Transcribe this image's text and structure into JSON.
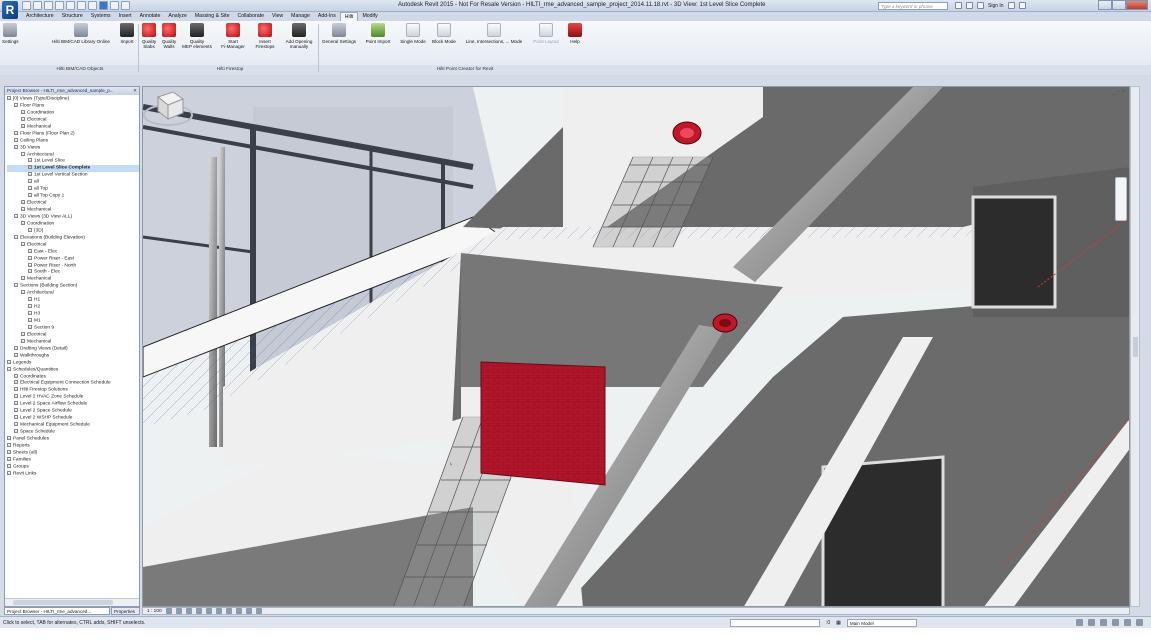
{
  "title": "Autodesk Revit 2015 - Not For Resale Version -   HILTI_rme_advanced_sample_project_2014.11.18.rvt - 3D View: 1st Level Slice Complete",
  "search_placeholder": "Type a keyword or phrase",
  "sign_in": "Sign In",
  "tabs": [
    "Architecture",
    "Structure",
    "Systems",
    "Insert",
    "Annotate",
    "Analyze",
    "Massing & Site",
    "Collaborate",
    "View",
    "Manage",
    "Add-Ins",
    "Hilti",
    "Modify"
  ],
  "active_tab": "Hilti",
  "ribbon": {
    "buttons": [
      {
        "label": "Settings",
        "icon": "settings-icon"
      },
      {
        "label": "Hilti BIM/CAD Library Online",
        "icon": "library-icon"
      },
      {
        "label": "Import",
        "icon": "import-icon"
      },
      {
        "label": "Quality\nSlabs",
        "icon": "quality-slabs-icon"
      },
      {
        "label": "Quality\nWalls",
        "icon": "quality-walls-icon"
      },
      {
        "label": "Quality\nMEP elements",
        "icon": "quality-mep-icon"
      },
      {
        "label": "Start\nFi-Manager",
        "icon": "fi-manager-icon"
      },
      {
        "label": "Insert\nFirestops",
        "icon": "insert-firestops-icon"
      },
      {
        "label": "Add Opening\nmanually",
        "icon": "add-opening-icon"
      },
      {
        "label": "General Settings",
        "icon": "general-settings-icon"
      },
      {
        "label": "Point Import",
        "icon": "point-import-icon"
      },
      {
        "label": "Single Mode",
        "icon": "single-mode-icon"
      },
      {
        "label": "Block Mode",
        "icon": "block-mode-icon"
      },
      {
        "label": "Line, Intersections, ... Mode",
        "icon": "line-mode-icon"
      },
      {
        "label": "Point Layout",
        "icon": "point-layout-icon"
      },
      {
        "label": "Help",
        "icon": "help-icon"
      }
    ],
    "panels": [
      "Hilti BIM/CAD Objects",
      "Hilti Firestop",
      "Hilti Point Creator for Revit"
    ]
  },
  "browser": {
    "title": "Project Browser - HILTI_rme_advanced_sample_p...",
    "nodes": [
      {
        "t": "[0] Views (Type/Discipline)",
        "d": 0
      },
      {
        "t": "Floor Plans",
        "d": 1
      },
      {
        "t": "Coordination",
        "d": 2
      },
      {
        "t": "Electrical",
        "d": 2
      },
      {
        "t": "Mechanical",
        "d": 2
      },
      {
        "t": "Floor Plans (Floor Plan 2)",
        "d": 1
      },
      {
        "t": "Ceiling Plans",
        "d": 1
      },
      {
        "t": "3D Views",
        "d": 1
      },
      {
        "t": "Architectural",
        "d": 2
      },
      {
        "t": "1st Level Slice",
        "d": 3
      },
      {
        "t": "1st Level Slice Complete",
        "d": 3,
        "sel": true
      },
      {
        "t": "1st Level Vertical Section",
        "d": 3
      },
      {
        "t": "all",
        "d": 3
      },
      {
        "t": "all Top",
        "d": 3
      },
      {
        "t": "all Top Copy 1",
        "d": 3
      },
      {
        "t": "Electrical",
        "d": 2
      },
      {
        "t": "Mechanical",
        "d": 2
      },
      {
        "t": "3D Views (3D View ALL)",
        "d": 1
      },
      {
        "t": "Coordination",
        "d": 2
      },
      {
        "t": "{3D}",
        "d": 3
      },
      {
        "t": "Elevations (Building Elevation)",
        "d": 1
      },
      {
        "t": "Electrical",
        "d": 2
      },
      {
        "t": "East - Elec",
        "d": 3
      },
      {
        "t": "Power Riser - East",
        "d": 3
      },
      {
        "t": "Power Riser - North",
        "d": 3
      },
      {
        "t": "South - Elec",
        "d": 3
      },
      {
        "t": "Mechanical",
        "d": 2
      },
      {
        "t": "Sections (Building Section)",
        "d": 1
      },
      {
        "t": "Architectural",
        "d": 2
      },
      {
        "t": "H1",
        "d": 3
      },
      {
        "t": "H2",
        "d": 3
      },
      {
        "t": "H3",
        "d": 3
      },
      {
        "t": "M1",
        "d": 3
      },
      {
        "t": "Section 9",
        "d": 3
      },
      {
        "t": "Electrical",
        "d": 2
      },
      {
        "t": "Mechanical",
        "d": 2
      },
      {
        "t": "Drafting Views (Detail)",
        "d": 1
      },
      {
        "t": "Walkthroughs",
        "d": 1
      },
      {
        "t": "Legends",
        "d": 0
      },
      {
        "t": "Schedules/Quantities",
        "d": 0
      },
      {
        "t": "Coordinates",
        "d": 1
      },
      {
        "t": "Electrical Equipment Connection Schedule",
        "d": 1
      },
      {
        "t": "Hilti Firestop Solutions",
        "d": 1
      },
      {
        "t": "Level 2 HVAC Zone Schedule",
        "d": 1
      },
      {
        "t": "Level 2 Space Airflow Schedule",
        "d": 1
      },
      {
        "t": "Level 2 Space Schedule",
        "d": 1
      },
      {
        "t": "Level 2 WSHP Schedule",
        "d": 1
      },
      {
        "t": "Mechanical Equipment Schedule",
        "d": 1
      },
      {
        "t": "Space Schedule",
        "d": 1
      },
      {
        "t": "Panel Schedules",
        "d": 0
      },
      {
        "t": "Reports",
        "d": 0
      },
      {
        "t": "Sheets (all)",
        "d": 0
      },
      {
        "t": "Families",
        "d": 0
      },
      {
        "t": "Groups",
        "d": 0
      },
      {
        "t": "Revit Links",
        "d": 0
      }
    ],
    "tab_browser": "Project Browser - HILTI_rme_advanced...",
    "tab_properties": "Properties"
  },
  "view_scale": "1 : 100",
  "status_text": "Click to select, TAB for alternates, CTRL adds, SHIFT unselects.",
  "workset": ":0",
  "model": "Main Model",
  "colors": {
    "accent": "#c0182a",
    "wall": "#6d6d6d",
    "floor_edge": "#ffffff"
  }
}
